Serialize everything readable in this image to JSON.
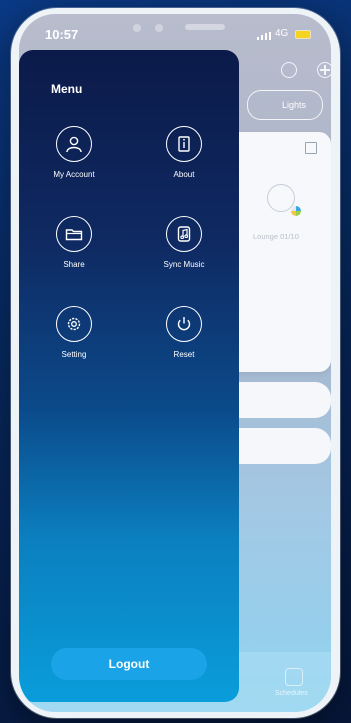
{
  "status_bar": {
    "time": "10:57",
    "network": "4G"
  },
  "background_app": {
    "filter_pill": "Lights",
    "device_card_label": "Lounge 01/10",
    "bottom_tab_label": "Schedules"
  },
  "menu": {
    "title": "Menu",
    "items": [
      {
        "label": "My Account",
        "icon": "person-icon"
      },
      {
        "label": "About",
        "icon": "info-document-icon"
      },
      {
        "label": "Share",
        "icon": "folder-icon"
      },
      {
        "label": "Sync Music",
        "icon": "music-note-icon"
      },
      {
        "label": "Setting",
        "icon": "gear-icon"
      },
      {
        "label": "Reset",
        "icon": "power-icon"
      }
    ],
    "logout_label": "Logout"
  },
  "colors": {
    "drawer_top": "#0b1a49",
    "drawer_bottom": "#0a9ddb",
    "logout_button": "#1aa3e6",
    "page_background": "#08295f"
  }
}
